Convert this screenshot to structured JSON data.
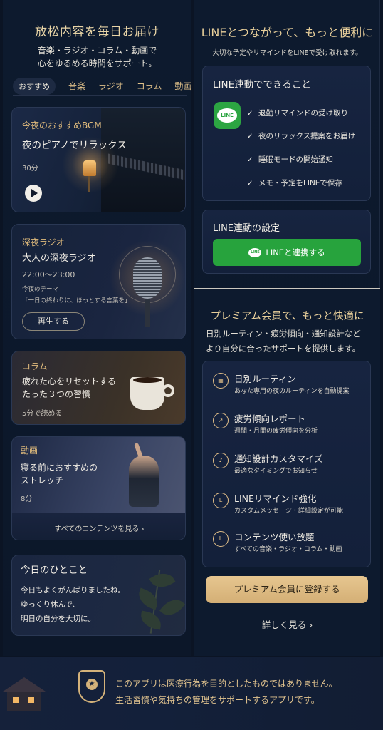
{
  "left": {
    "title": "放松内容を毎日お届け",
    "subtitle_line1": "音楽・ラジオ・コラム・動画で",
    "subtitle_line2": "心をゆるめる時間をサポート。",
    "tabs": [
      "おすすめ",
      "音楽",
      "ラジオ",
      "コラム",
      "動画"
    ],
    "bgm_card": {
      "label": "今夜のおすすめBGM",
      "title": "夜のピアノでリラックス",
      "duration": "30分"
    },
    "radio_card": {
      "label": "深夜ラジオ",
      "title": "大人の深夜ラジオ",
      "time": "22:00〜23:00",
      "theme_label": "今夜のテーマ",
      "theme": "「一日の終わりに、ほっとする言葉を」",
      "button": "再生する"
    },
    "column_card": {
      "label": "コラム",
      "title_line1": "疲れた心をリセットする",
      "title_line2": "たった３つの習慣",
      "meta": "5分で読める"
    },
    "video_card": {
      "label": "動画",
      "title_line1": "寝る前におすすめの",
      "title_line2": "ストレッチ",
      "duration": "8分",
      "see_all": "すべてのコンテンツを見る ›"
    },
    "quote_card": {
      "title": "今日のひとこと",
      "line1": "今日もよくがんばりましたね。",
      "line2": "ゆっくり休んで、",
      "line3": "明日の自分を大切に。"
    }
  },
  "right": {
    "title": "LINEとつながって、もっと便利に",
    "subtitle": "大切な予定やリマインドをLINEで受け取れます。",
    "can_do": {
      "title": "LINE連動でできること",
      "icon_text": "LINE",
      "items": [
        "退勤リマインドの受け取り",
        "夜のリラックス提案をお届け",
        "睡眠モードの開始通知",
        "メモ・予定をLINEで保存"
      ]
    },
    "settings": {
      "title": "LINE連動の設定",
      "button": "LINEと連携する",
      "button_icon_text": "LINE"
    },
    "premium": {
      "title": "プレミアム会員で、もっと快適に",
      "subtitle_line1": "日別ルーティン・疲労傾向・通知設計など",
      "subtitle_line2": "より自分に合ったサポートを提供します。",
      "features": [
        {
          "icon": "calendar-icon",
          "title": "日別ルーティン",
          "desc": "あなた専用の夜のルーティンを自動提案"
        },
        {
          "icon": "chart-icon",
          "title": "疲労傾向レポート",
          "desc": "週間・月間の疲労傾向を分析"
        },
        {
          "icon": "bell-icon",
          "title": "通知設計カスタマイズ",
          "desc": "最適なタイミングでお知らせ"
        },
        {
          "icon": "line-icon",
          "title": "LINEリマインド強化",
          "desc": "カスタムメッセージ・詳細設定が可能"
        },
        {
          "icon": "line-icon",
          "title": "コンテンツ使い放題",
          "desc": "すべての音楽・ラジオ・コラム・動画"
        }
      ],
      "button": "プレミアム会員に登録する",
      "more": "詳しく見る ›"
    }
  },
  "footer": {
    "line1": "このアプリは医療行為を目的としたものではありません。",
    "line2": "生活習慣や気持ちの管理をサポートするアプリです。"
  },
  "colors": {
    "accent_gold": "#e2c48f",
    "line_green": "#27a33d",
    "background": "#0b1424"
  }
}
